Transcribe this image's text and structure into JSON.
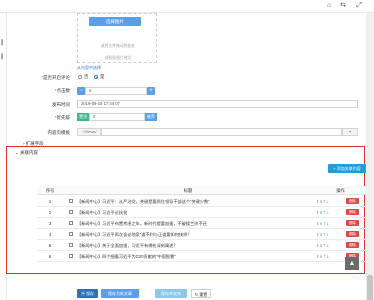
{
  "topbar": {
    "home_icon": "home-icon",
    "share_icon": "share-icon",
    "expand_icon": "expand-icon"
  },
  "upload": {
    "button_label": "选择图片",
    "hint_1": "或将文件拖动到此处",
    "hint_2": "或粘贴图片地址",
    "from_library": "从内容中选择"
  },
  "form": {
    "allow_comment": {
      "label": "是否开启评论",
      "options": [
        "否",
        "是"
      ],
      "selected": "是"
    },
    "clicks": {
      "label": "点击数",
      "value": "0"
    },
    "publish_time": {
      "label": "发布时间",
      "value": "2019-09-16 17:44:07"
    },
    "priority": {
      "label": "优先级",
      "left_btn": "置顶",
      "value": "0",
      "right_btn": "推荐"
    },
    "template": {
      "label": "内容页模板",
      "prefix": "~/Views/",
      "value": ""
    },
    "ext_fields": {
      "label": "扩展字段"
    }
  },
  "related": {
    "title": "关联内容",
    "add_button": "添加关联内容",
    "columns": [
      "序号",
      "标题",
      "操作"
    ],
    "delete_label": "删除",
    "rows": [
      {
        "no": "1",
        "title": "【新闻中心】习近平：从严治党，关键是要抓住领导干部这个“关键少数”"
      },
      {
        "no": "2",
        "title": "【新闻中心】习近平论扶贫"
      },
      {
        "no": "3",
        "title": "【新闻中心】习近平布置考虑之年，新时代提要加速，不破楼兰终不还"
      },
      {
        "no": "4",
        "title": "【新闻中心】习近平再次谈论地泉“道不利与正道要如何抉择？"
      },
      {
        "no": "5",
        "title": "【新闻中心】关于全面加强，习近平有哪些深刻阐述？"
      },
      {
        "no": "6",
        "title": "【新闻中心】四个细看习近平为G20贡献的“中国智慧”"
      }
    ]
  },
  "footer": {
    "save": "保存",
    "save_add": "保存为新文章",
    "save_publish": "保存并发布",
    "reset": "重置"
  }
}
